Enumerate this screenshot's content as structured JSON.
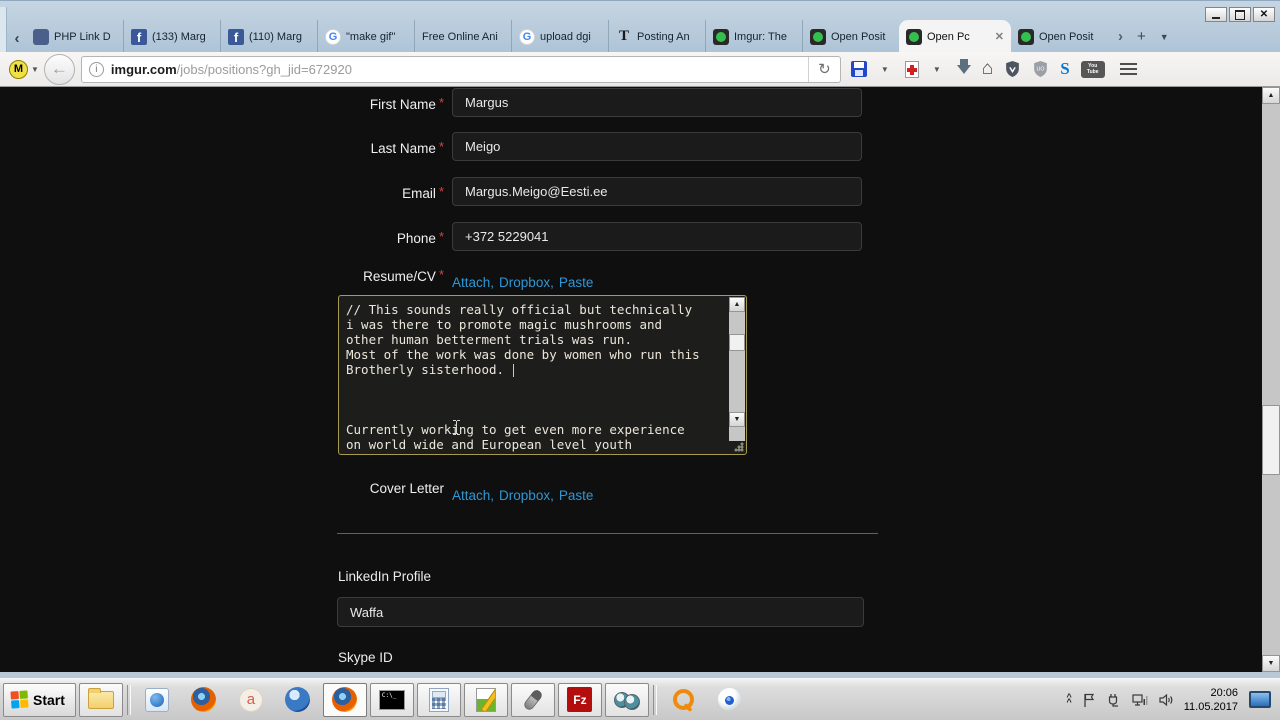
{
  "browser": {
    "tab_scroll_left": "‹",
    "tab_overflow_right": "›",
    "new_tab": "+",
    "tabs": [
      {
        "label": "PHP Link D",
        "icon": "php"
      },
      {
        "label": "(133) Marg",
        "icon": "facebook"
      },
      {
        "label": "(110) Marg",
        "icon": "facebook"
      },
      {
        "label": "\"make gif\"",
        "icon": "google"
      },
      {
        "label": "Free Online Ani",
        "icon": "none"
      },
      {
        "label": "upload dgi",
        "icon": "google"
      },
      {
        "label": "Posting An",
        "icon": "times"
      },
      {
        "label": "Imgur: The",
        "icon": "greenhouse"
      },
      {
        "label": "Open Posit",
        "icon": "greenhouse"
      },
      {
        "label": "Open Pc",
        "icon": "greenhouse",
        "active": true,
        "close": "✕"
      },
      {
        "label": "Open Posit",
        "icon": "greenhouse"
      }
    ],
    "nav": {
      "extension_badge": "M",
      "back_glyph": "←",
      "info_glyph": "i",
      "reload_glyph": "↻",
      "home_glyph": "⌂",
      "url_domain": "imgur.com",
      "url_path": "/jobs/positions?gh_jid=672920"
    }
  },
  "form": {
    "fields": [
      {
        "label": "First Name",
        "required": "*",
        "value": "Margus"
      },
      {
        "label": "Last Name",
        "required": "*",
        "value": "Meigo"
      },
      {
        "label": "Email",
        "required": "*",
        "value": "Margus.Meigo@Eesti.ee"
      },
      {
        "label": "Phone",
        "required": "*",
        "value": "+372 5229041"
      }
    ],
    "resume": {
      "label": "Resume/CV",
      "required": "*",
      "links": [
        "Attach",
        "Dropbox",
        "Paste"
      ],
      "separator": ",",
      "text": "// This sounds really official but technically\ni was there to promote magic mushrooms and\nother human betterment trials was run.\nMost of the work was done by women who run this\nBrotherly sisterhood. \n\n\n\nCurrently working to get even more experience\non world wide and European level youth"
    },
    "cover_letter": {
      "label": "Cover Letter",
      "links": [
        "Attach",
        "Dropbox",
        "Paste"
      ],
      "separator": ","
    },
    "linkedin": {
      "label": "LinkedIn Profile",
      "value": "Waffa"
    },
    "skype": {
      "label": "Skype ID"
    }
  },
  "taskbar": {
    "start_label": "Start",
    "clock": {
      "time": "20:06",
      "date": "11.05.2017"
    }
  },
  "colors": {
    "link_blue": "#2e97d5",
    "required_red": "#e04040",
    "textarea_focus_border": "#a89a4e",
    "greenhouse_green": "#35c04d",
    "page_background": "#0f0f0f"
  }
}
